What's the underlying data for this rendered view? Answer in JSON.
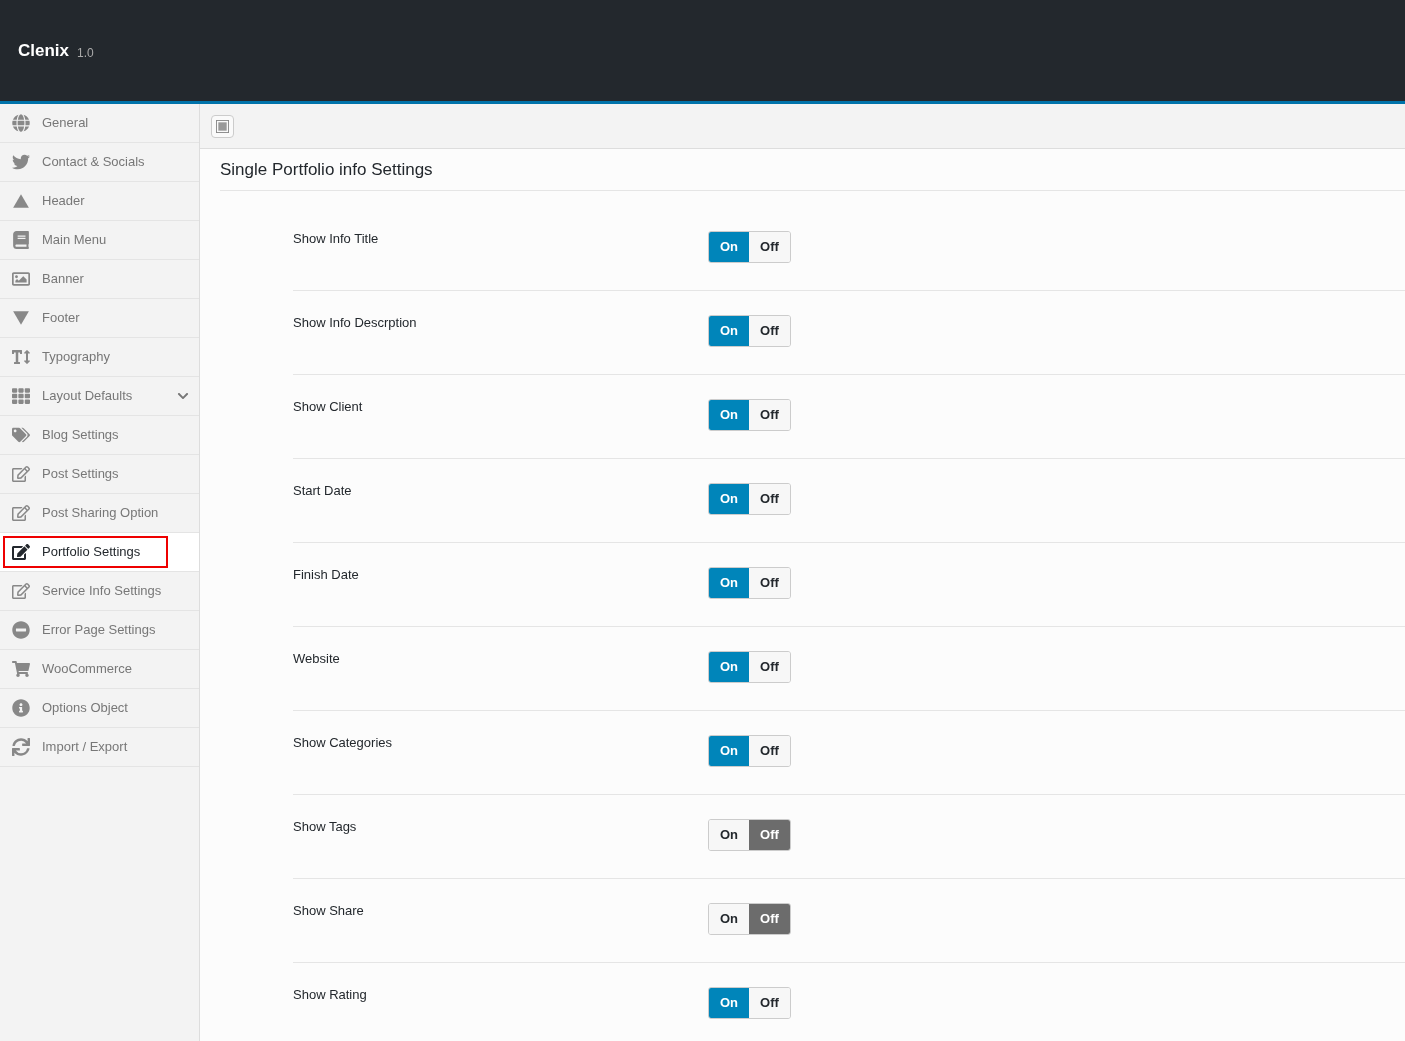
{
  "header": {
    "brand": "Clenix",
    "version": "1.0"
  },
  "sidebar": {
    "items": [
      {
        "label": "General",
        "selected": false,
        "kind": "page"
      },
      {
        "label": "Contact & Socials",
        "selected": false,
        "kind": "page"
      },
      {
        "label": "Header",
        "selected": false,
        "kind": "page"
      },
      {
        "label": "Main Menu",
        "selected": false,
        "kind": "page"
      },
      {
        "label": "Banner",
        "selected": false,
        "kind": "page"
      },
      {
        "label": "Footer",
        "selected": false,
        "kind": "page"
      },
      {
        "label": "Typography",
        "selected": false,
        "kind": "page"
      },
      {
        "label": "Layout Defaults",
        "selected": false,
        "kind": "group"
      },
      {
        "label": "Blog Settings",
        "selected": false,
        "kind": "page"
      },
      {
        "label": "Post Settings",
        "selected": false,
        "kind": "page"
      },
      {
        "label": "Post Sharing Option",
        "selected": false,
        "kind": "page"
      },
      {
        "label": "Portfolio Settings",
        "selected": true,
        "kind": "page"
      },
      {
        "label": "Service Info Settings",
        "selected": false,
        "kind": "page"
      },
      {
        "label": "Error Page Settings",
        "selected": false,
        "kind": "page"
      },
      {
        "label": "WooCommerce",
        "selected": false,
        "kind": "page"
      },
      {
        "label": "Options Object",
        "selected": false,
        "kind": "page"
      },
      {
        "label": "Import / Export",
        "selected": false,
        "kind": "page"
      }
    ]
  },
  "section": {
    "title": "Single Portfolio info Settings",
    "settings": [
      {
        "label": "Show Info Title",
        "on_label": "On",
        "off_label": "Off",
        "on": true
      },
      {
        "label": "Show Info Descrption",
        "on_label": "On",
        "off_label": "Off",
        "on": true
      },
      {
        "label": "Show Client",
        "on_label": "On",
        "off_label": "Off",
        "on": true
      },
      {
        "label": "Start Date",
        "on_label": "On",
        "off_label": "Off",
        "on": true
      },
      {
        "label": "Finish Date",
        "on_label": "On",
        "off_label": "Off",
        "on": true
      },
      {
        "label": "Website",
        "on_label": "On",
        "off_label": "Off",
        "on": true
      },
      {
        "label": "Show Categories",
        "on_label": "On",
        "off_label": "Off",
        "on": true
      },
      {
        "label": "Show Tags",
        "on_label": "On",
        "off_label": "Off",
        "on": false
      },
      {
        "label": "Show Share",
        "on_label": "On",
        "off_label": "Off",
        "on": false
      },
      {
        "label": "Show Rating",
        "on_label": "On",
        "off_label": "Off",
        "on": true
      }
    ]
  }
}
